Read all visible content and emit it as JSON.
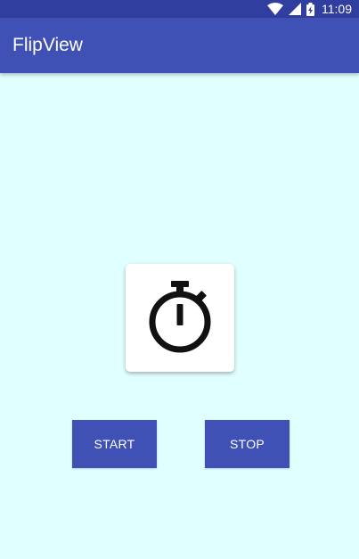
{
  "status_bar": {
    "time": "11:09",
    "icons": [
      "wifi-icon",
      "signal-icon",
      "battery-charging-icon"
    ]
  },
  "app_bar": {
    "title": "FlipView"
  },
  "card": {
    "icon": "stopwatch-icon"
  },
  "buttons": {
    "start_label": "START",
    "stop_label": "STOP"
  },
  "colors": {
    "status_bar": "#303F9F",
    "app_bar": "#3F51B5",
    "background": "#E0FFFF",
    "button": "#3F51B5"
  }
}
